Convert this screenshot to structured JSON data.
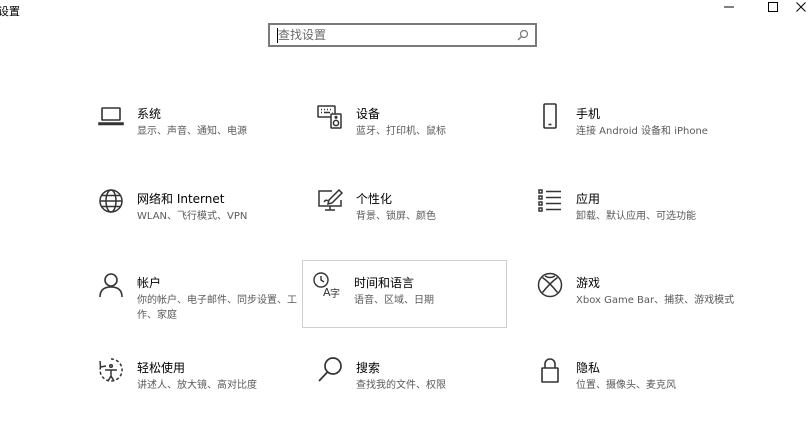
{
  "window": {
    "title": "设置"
  },
  "search": {
    "placeholder": "查找设置"
  },
  "tiles": [
    {
      "title": "系统",
      "desc": "显示、声音、通知、电源",
      "icon": "laptop-icon"
    },
    {
      "title": "设备",
      "desc": "蓝牙、打印机、鼠标",
      "icon": "keyboard-speaker-icon"
    },
    {
      "title": "手机",
      "desc": "连接 Android 设备和 iPhone",
      "icon": "phone-icon"
    },
    {
      "title": "网络和 Internet",
      "desc": "WLAN、飞行模式、VPN",
      "icon": "globe-icon"
    },
    {
      "title": "个性化",
      "desc": "背景、锁屏、颜色",
      "icon": "monitor-pen-icon"
    },
    {
      "title": "应用",
      "desc": "卸载、默认应用、可选功能",
      "icon": "apps-list-icon"
    },
    {
      "title": "帐户",
      "desc": "你的帐户、电子邮件、同步设置、工作、家庭",
      "icon": "person-icon"
    },
    {
      "title": "时间和语言",
      "desc": "语音、区域、日期",
      "icon": "time-language-icon"
    },
    {
      "title": "游戏",
      "desc": "Xbox Game Bar、捕获、游戏模式",
      "icon": "xbox-icon"
    },
    {
      "title": "轻松使用",
      "desc": "讲述人、放大镜、高对比度",
      "icon": "ease-of-access-icon"
    },
    {
      "title": "搜索",
      "desc": "查找我的文件、权限",
      "icon": "search-icon"
    },
    {
      "title": "隐私",
      "desc": "位置、摄像头、麦克风",
      "icon": "lock-icon"
    }
  ]
}
